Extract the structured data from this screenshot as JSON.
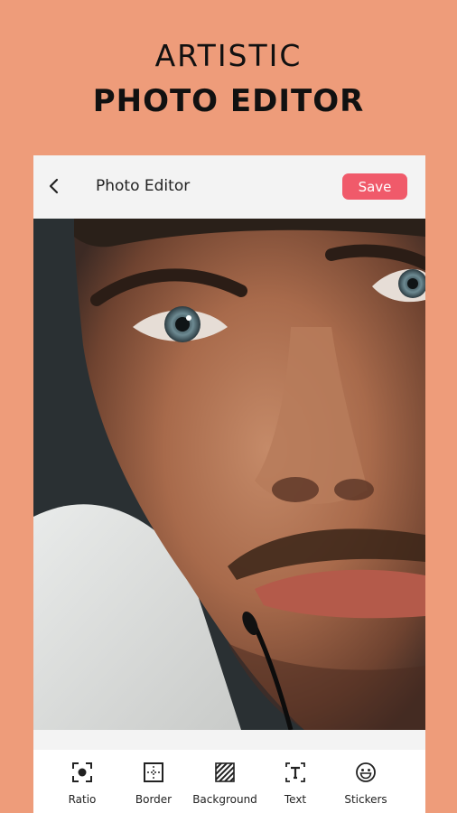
{
  "promo": {
    "line1": "ARTISTIC",
    "line2": "PHOTO EDITOR"
  },
  "app_bar": {
    "back_icon": "back-arrow-icon",
    "title": "Photo Editor",
    "save_label": "Save"
  },
  "photo": {
    "subject": "close-up portrait of a man's face"
  },
  "toolbar": {
    "items": [
      {
        "label": "Ratio",
        "icon": "ratio-icon"
      },
      {
        "label": "Border",
        "icon": "border-icon"
      },
      {
        "label": "Background",
        "icon": "background-icon"
      },
      {
        "label": "Text",
        "icon": "text-icon"
      },
      {
        "label": "Stickers",
        "icon": "stickers-icon"
      }
    ]
  },
  "colors": {
    "background": "#EE9C7A",
    "save_button": "#F05A6A",
    "app_bar": "#F3F3F3"
  }
}
